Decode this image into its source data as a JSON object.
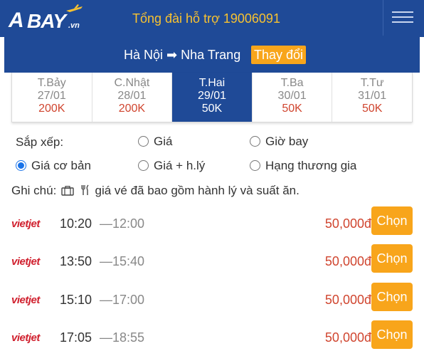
{
  "header": {
    "logo_text": "BAY",
    "logo_suffix": ".vn",
    "hotline": "Tổng đài hỗ trợ 19006091"
  },
  "route": {
    "from": "Hà Nội",
    "arrow": "➡",
    "to": "Nha Trang",
    "change_label": "Thay đổi"
  },
  "dates": [
    {
      "day": "T.Bảy",
      "date": "27/01",
      "price": "200K",
      "active": false
    },
    {
      "day": "C.Nhật",
      "date": "28/01",
      "price": "200K",
      "active": false
    },
    {
      "day": "T.Hai",
      "date": "29/01",
      "price": "50K",
      "active": true
    },
    {
      "day": "T.Ba",
      "date": "30/01",
      "price": "50K",
      "active": false
    },
    {
      "day": "T.Tư",
      "date": "31/01",
      "price": "50K",
      "active": false
    }
  ],
  "sort": {
    "label": "Sắp xếp:",
    "options": [
      {
        "label": "Giá",
        "selected": false
      },
      {
        "label": "Giờ bay",
        "selected": false
      },
      {
        "label": "Giá cơ bản",
        "selected": true
      },
      {
        "label": "Giá + h.lý",
        "selected": false
      },
      {
        "label": "Hạng thương gia",
        "selected": false
      }
    ]
  },
  "note": {
    "prefix": "Ghi chú:",
    "text": "giá vé đã bao gồm hành lý và suất ăn."
  },
  "flights": [
    {
      "airline": "vietjet",
      "depart": "10:20",
      "arrive": "—12:00",
      "price": "50,000đ",
      "action": "Chọn"
    },
    {
      "airline": "vietjet",
      "depart": "13:50",
      "arrive": "—15:40",
      "price": "50,000đ",
      "action": "Chọn"
    },
    {
      "airline": "vietjet",
      "depart": "15:10",
      "arrive": "—17:00",
      "price": "50,000đ",
      "action": "Chọn"
    },
    {
      "airline": "vietjet",
      "depart": "17:05",
      "arrive": "—18:55",
      "price": "50,000đ",
      "action": "Chọn"
    }
  ],
  "colors": {
    "brand_blue": "#1f4a97",
    "accent_orange": "#f8a51b",
    "hotline_yellow": "#f8c230",
    "price_red": "#d0452f"
  }
}
